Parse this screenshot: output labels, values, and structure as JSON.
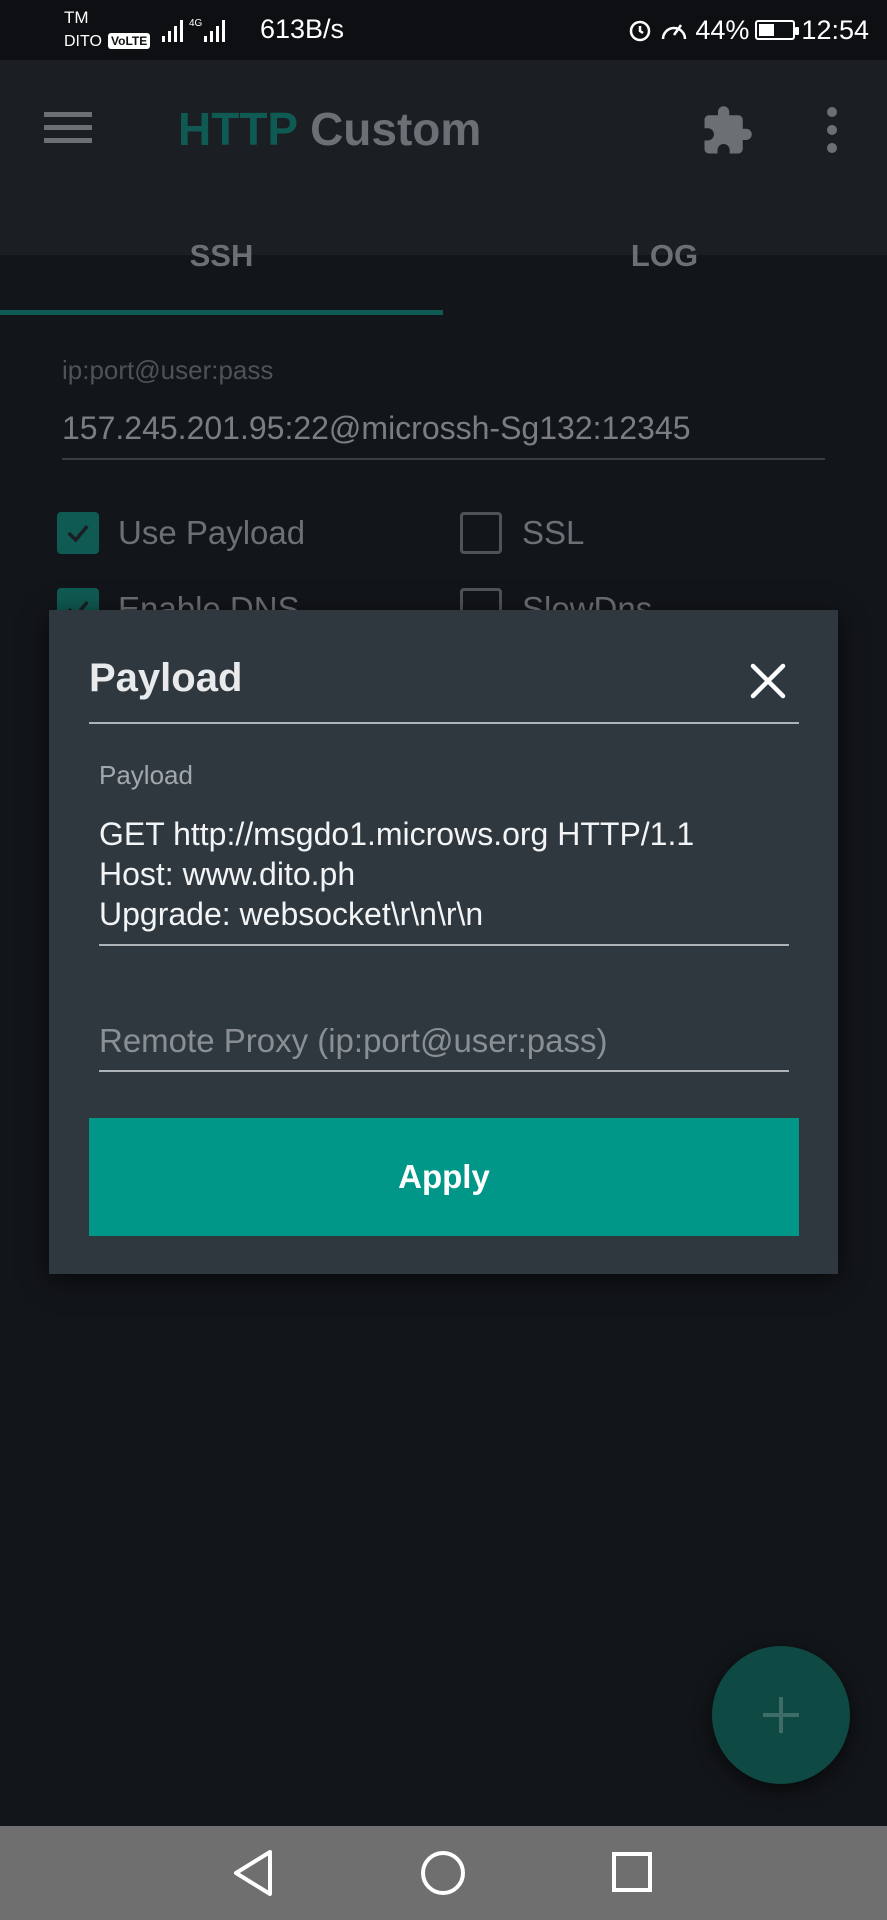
{
  "status_bar": {
    "carrier_top": "TM",
    "carrier_bottom": "DITO",
    "volte": "VoLTE",
    "net_speed": "613B/s",
    "battery": "44%",
    "time": "12:54",
    "battery_level": 0.44
  },
  "app_bar": {
    "title_part1": "HTTP",
    "title_part2": "Custom",
    "icons": [
      "menu-icon",
      "puzzle-icon",
      "more-vert-icon"
    ]
  },
  "tabs": [
    {
      "label": "SSH",
      "selected": true
    },
    {
      "label": "LOG",
      "selected": false
    }
  ],
  "form": {
    "ssh_label": "ip:port@user:pass",
    "ssh_value": "157.245.201.95:22@microssh-Sg132:12345",
    "checkboxes": [
      {
        "label": "Use Payload",
        "checked": true
      },
      {
        "label": "SSL",
        "checked": false
      },
      {
        "label": "Enable DNS",
        "checked": true
      },
      {
        "label": "SlowDns",
        "checked": false
      }
    ]
  },
  "dialog": {
    "title": "Payload",
    "payload_label": "Payload",
    "payload_value": "GET http://msgdo1.microws.org HTTP/1.1\nHost: www.dito.ph\nUpgrade: websocket\\r\\n\\r\\n",
    "proxy_placeholder": "Remote Proxy (ip:port@user:pass)",
    "apply_label": "Apply"
  },
  "colors": {
    "accent": "#009688",
    "dialog_bg": "#2f383f",
    "app_bg": "#121519"
  }
}
